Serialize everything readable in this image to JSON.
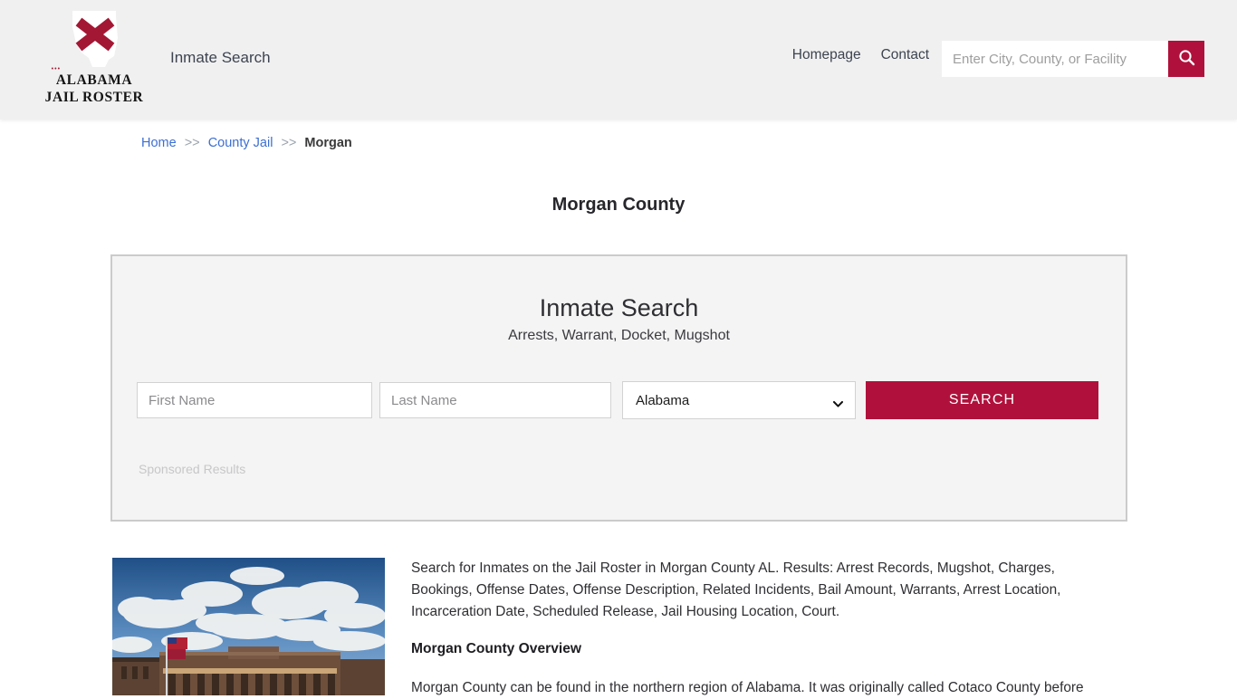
{
  "header": {
    "brand": {
      "line1": "ALABAMA",
      "line2": "JAIL ROSTER",
      "mark_icon": "alabama-flag-state-icon"
    },
    "tagline": "Inmate Search",
    "links": [
      {
        "label": "Homepage"
      },
      {
        "label": "Contact"
      }
    ],
    "search": {
      "value": "",
      "placeholder": "Enter City, County, or Facility",
      "button_icon": "search-icon"
    },
    "background_color": "#f0f0f0"
  },
  "breadcrumb": {
    "items": [
      {
        "label": "Home",
        "type": "link"
      },
      {
        "label": ">>",
        "type": "separator"
      },
      {
        "label": "County Jail",
        "type": "link"
      },
      {
        "label": ">>",
        "type": "separator"
      },
      {
        "label": "Morgan",
        "type": "current"
      }
    ]
  },
  "page": {
    "title": "Morgan County"
  },
  "search_panel": {
    "title": "Inmate Search",
    "subtitle": "Arrests, Warrant, Docket, Mugshot",
    "first_name": {
      "value": "",
      "placeholder": "First Name"
    },
    "last_name": {
      "value": "",
      "placeholder": "Last Name"
    },
    "state_select": {
      "selected": "Alabama",
      "options": [
        "Alabama"
      ],
      "caret_icon": "chevron-down-icon"
    },
    "search_button": "SEARCH",
    "sponsored_label": "Sponsored Results",
    "accent_color": "#b0113c",
    "background_color": "#f4f4f4",
    "border_color": "#cbcbcb"
  },
  "content": {
    "thumbnail_alt": "morgan-county-courthouse-photo",
    "intro": "Search for Inmates on the Jail Roster in Morgan County AL. Results: Arrest Records, Mugshot, Charges, Bookings, Offense Dates, Offense Description, Related Incidents, Bail Amount, Warrants, Arrest Location, Incarceration Date, Scheduled Release, Jail Housing Location, Court.",
    "overview_heading": "Morgan County Overview",
    "overview_text": "Morgan County can be found in the northern region of Alabama. It was originally called Cotaco County before"
  }
}
